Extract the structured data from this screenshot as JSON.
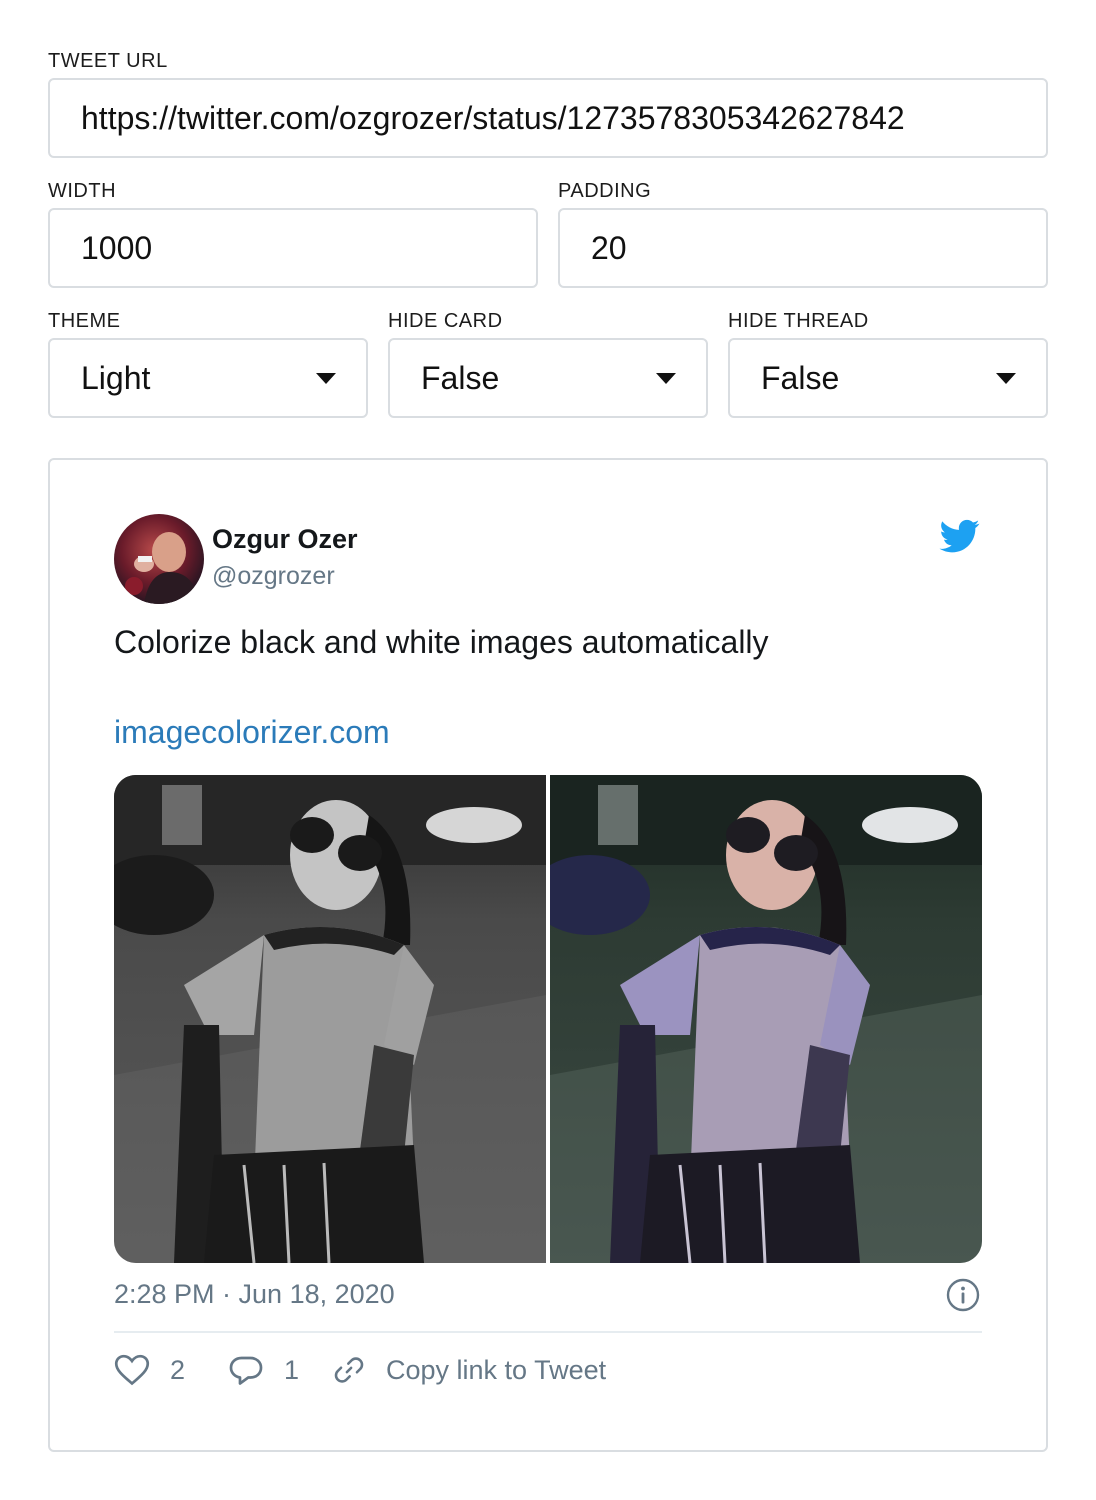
{
  "form": {
    "tweet_url": {
      "label": "TWEET URL",
      "value": "https://twitter.com/ozgrozer/status/1273578305342627842"
    },
    "width": {
      "label": "WIDTH",
      "value": "1000"
    },
    "padding": {
      "label": "PADDING",
      "value": "20"
    },
    "theme": {
      "label": "THEME",
      "value": "Light"
    },
    "hide_card": {
      "label": "HIDE CARD",
      "value": "False"
    },
    "hide_thread": {
      "label": "HIDE THREAD",
      "value": "False"
    }
  },
  "tweet": {
    "author_name": "Ozgur Ozer",
    "author_handle": "@ozgrozer",
    "text": "Colorize black and white images automatically",
    "link": "imagecolorizer.com",
    "timestamp": "2:28 PM · Jun 18, 2020",
    "likes": "2",
    "replies": "1",
    "copy_link": "Copy link to Tweet",
    "icons": [
      "twitter-bird-icon",
      "info-icon",
      "heart-icon",
      "reply-icon",
      "link-icon"
    ],
    "colors": {
      "link": "#2b7bb9",
      "bird": "#1da1f2",
      "muted": "#657786"
    }
  }
}
